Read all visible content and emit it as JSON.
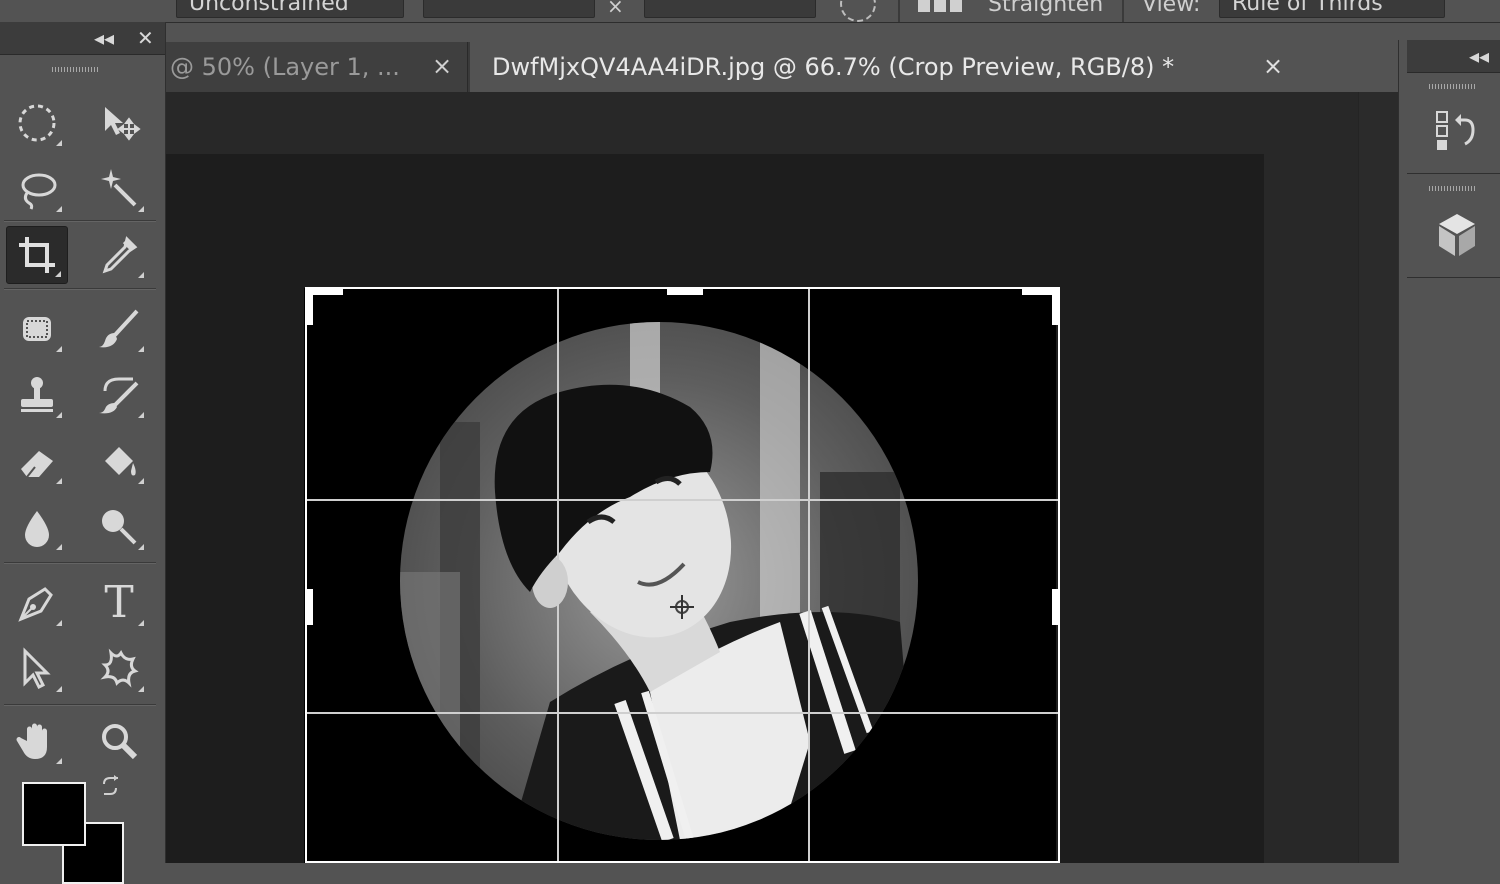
{
  "options_bar": {
    "aspect_preset": "Unconstrained",
    "swap_label": "×",
    "straighten_label": "Straighten",
    "view_label": "View:",
    "overlay_option": "Rule of Thirds"
  },
  "tools_panel": {
    "collapse_icon": "◂◂",
    "close_icon": "✕",
    "tools": [
      {
        "name": "rectangular-marquee-tool-icon"
      },
      {
        "name": "move-tool-icon"
      },
      {
        "name": "lasso-tool-icon"
      },
      {
        "name": "magic-wand-tool-icon"
      },
      {
        "name": "crop-tool-icon"
      },
      {
        "name": "eyedropper-tool-icon"
      },
      {
        "name": "spot-healing-tool-icon"
      },
      {
        "name": "brush-tool-icon"
      },
      {
        "name": "clone-stamp-tool-icon"
      },
      {
        "name": "history-brush-tool-icon"
      },
      {
        "name": "eraser-tool-icon"
      },
      {
        "name": "paint-bucket-tool-icon"
      },
      {
        "name": "blur-tool-icon"
      },
      {
        "name": "dodge-tool-icon"
      },
      {
        "name": "pen-tool-icon"
      },
      {
        "name": "type-tool-icon"
      },
      {
        "name": "path-selection-tool-icon"
      },
      {
        "name": "custom-shape-tool-icon"
      },
      {
        "name": "hand-tool-icon"
      },
      {
        "name": "zoom-tool-icon"
      }
    ],
    "type_tool_glyph": "T",
    "foreground_color": "#000000",
    "background_color": "#000000"
  },
  "tabs": [
    {
      "label": "@ 50% (Layer 1, ...",
      "close": "×"
    },
    {
      "label": "DwfMjxQV4AA4iDR.jpg @ 66.7% (Crop Preview, RGB/8) *",
      "close": "×"
    }
  ],
  "right_panel": {
    "collapse_icon": "◂◂",
    "icons": [
      "history-panel-icon",
      "3d-panel-icon"
    ]
  }
}
